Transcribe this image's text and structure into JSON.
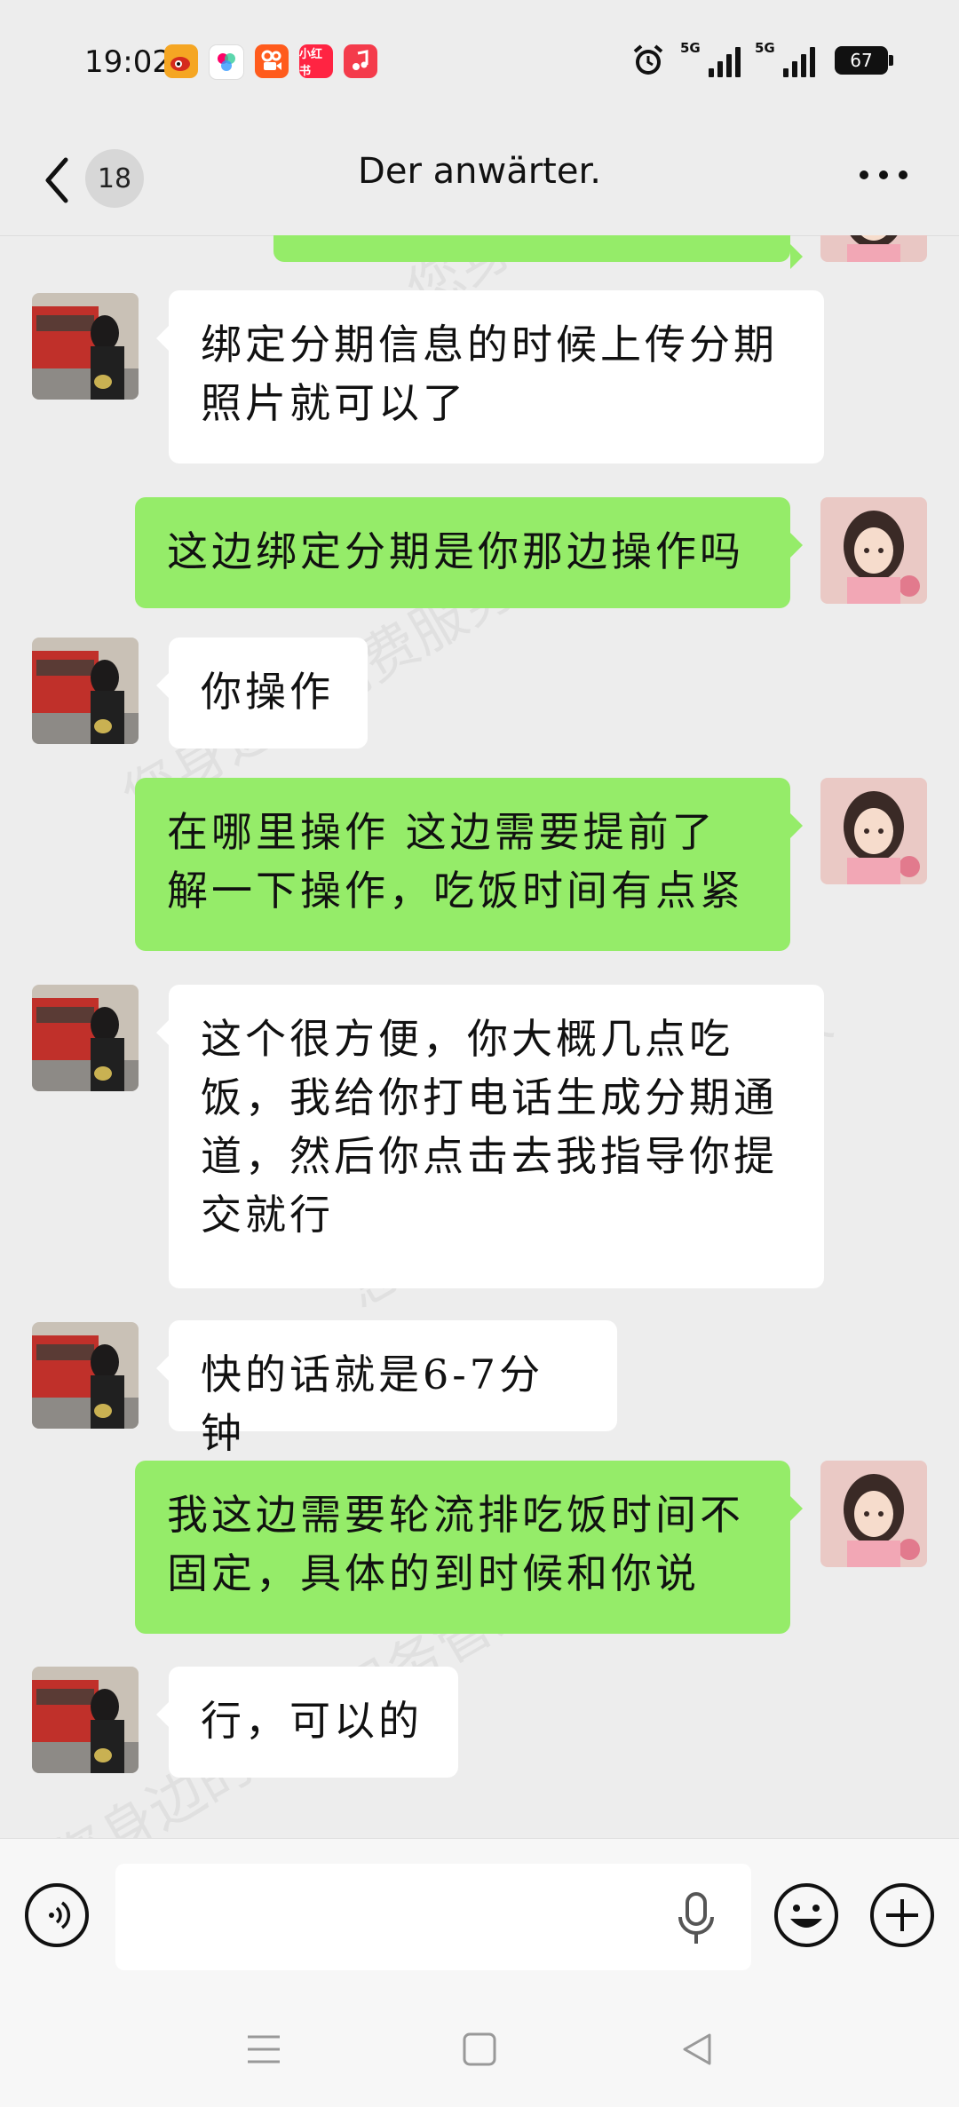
{
  "status_bar": {
    "time": "19:02",
    "network_1": "5G",
    "network_2": "5G",
    "battery": "67",
    "app_icons": [
      "weibo-icon",
      "photo-app-icon",
      "kuaishou-icon",
      "xiaohongshu-icon",
      "music-icon"
    ],
    "app_labels": {
      "xiaohongshu": "小红书"
    }
  },
  "header": {
    "unread_count": "18",
    "title": "Der anwärter."
  },
  "messages": [
    {
      "side": "in",
      "text": "绑定分期信息的时候上传分期照片就可以了"
    },
    {
      "side": "out",
      "text": "这边绑定分期是你那边操作吗"
    },
    {
      "side": "in",
      "text": "你操作"
    },
    {
      "side": "out",
      "text": "在哪里操作 这边需要提前了解一下操作，吃饭时间有点紧"
    },
    {
      "side": "in",
      "text": "这个很方便，你大概几点吃饭，我给你打电话生成分期通道，然后你点击去我指导你提交就行"
    },
    {
      "side": "in",
      "text": "快的话就是6-7分钟"
    },
    {
      "side": "out",
      "text": "我这边需要轮流排吃饭时间不固定，具体的到时候和你说"
    },
    {
      "side": "in",
      "text": "行，可以的"
    }
  ],
  "watermark": {
    "line1": "您身边的消费服务管家",
    "line2": "消费保"
  },
  "colors": {
    "outgoing_bubble": "#95ec69",
    "incoming_bubble": "#ffffff",
    "background": "#ededed"
  }
}
